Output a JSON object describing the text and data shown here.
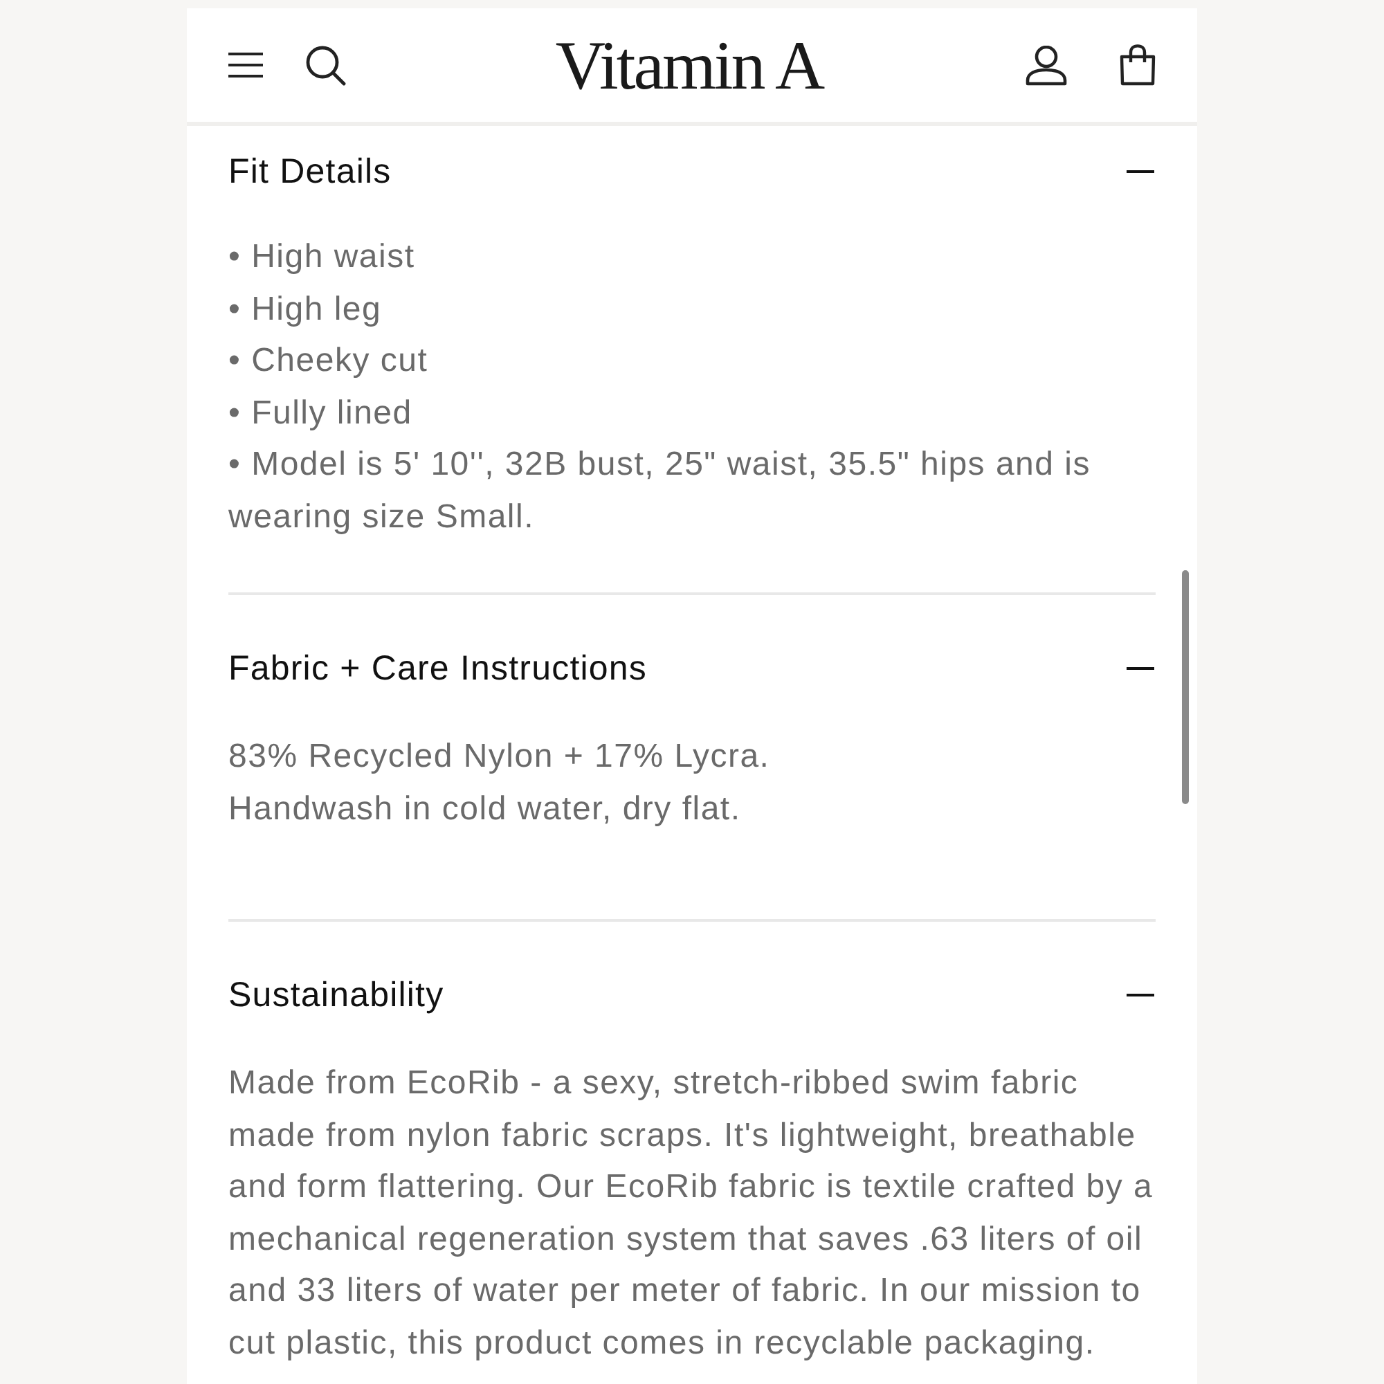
{
  "header": {
    "logo": "Vitamin A"
  },
  "sections": [
    {
      "title": "Fit Details",
      "expanded": true,
      "items": [
        "• High waist",
        "• High leg",
        "• Cheeky cut",
        "• Fully lined",
        "• Model is 5' 10'', 32B bust, 25\" waist, 35.5\" hips and is wearing size Small."
      ]
    },
    {
      "title": "Fabric + Care Instructions",
      "expanded": true,
      "items": [
        "83% Recycled Nylon + 17% Lycra.",
        "Handwash in cold water, dry flat."
      ]
    },
    {
      "title": "Sustainability",
      "expanded": true,
      "items": [
        "Made from EcoRib - a sexy, stretch-ribbed swim fabric made from nylon fabric scraps. It's lightweight, breathable and form flattering. Our EcoRib fabric is textile crafted by a mechanical regeneration system that saves .63 liters of oil and 33 liters of water per meter of fabric. In our mission to cut plastic, this product comes in recyclable packaging."
      ]
    }
  ]
}
